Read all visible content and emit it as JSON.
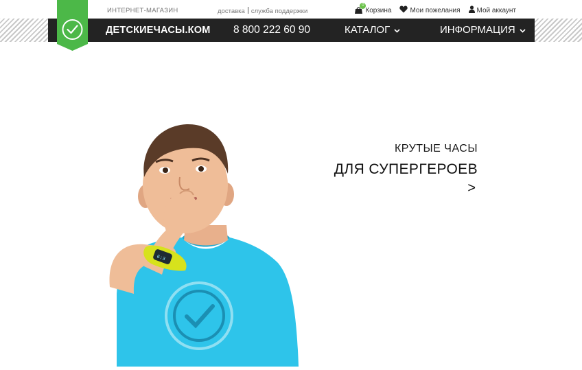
{
  "header": {
    "shop_label": "ИНТЕРНЕТ-МАГАЗИН",
    "links": [
      {
        "label": "доставка"
      },
      {
        "label": "служба поддержки"
      }
    ],
    "user_nav": {
      "cart_label": "Корзина",
      "cart_count": "0",
      "wishlist_label": "Мои пожелания",
      "account_label": "Мой аккаунт"
    }
  },
  "navbar": {
    "brand": "ДЕТСКИЕЧАСЫ.КОМ",
    "phone": "8 800 222 60 90",
    "menu": [
      {
        "label": "КАТАЛОГ"
      },
      {
        "label": "ИНФОРМАЦИЯ"
      }
    ]
  },
  "hero": {
    "line1": "КРУТЫЕ ЧАСЫ",
    "line2": "ДЛЯ СУПЕРГЕРОЕВ",
    "arrow": ">"
  },
  "colors": {
    "accent_green": "#4cb848",
    "navbar_bg": "#232323",
    "shirt_blue": "#2ec4ea",
    "watch_yellow": "#d7e21c"
  }
}
